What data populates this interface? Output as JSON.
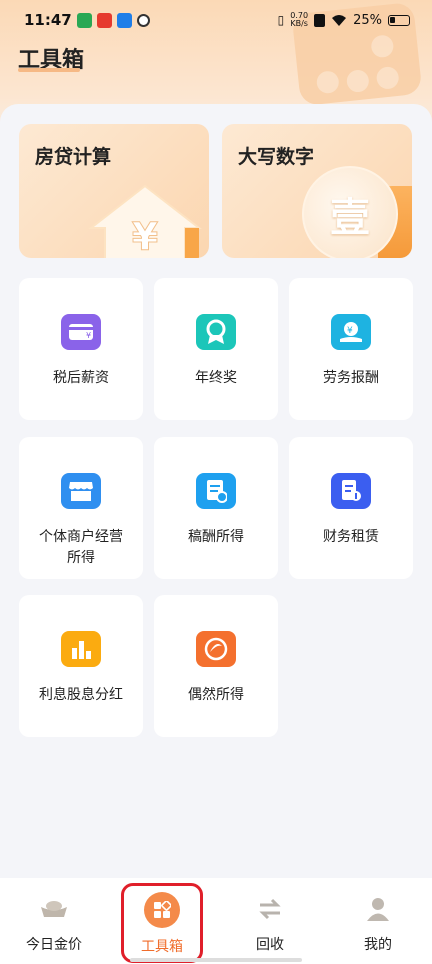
{
  "status_bar": {
    "time": "11:47",
    "net_speed_value": "0.70",
    "net_speed_unit": "KB/s",
    "battery": "25%"
  },
  "page": {
    "title": "工具箱"
  },
  "feature_cards": [
    {
      "label": "房贷计算",
      "symbol": "¥"
    },
    {
      "label": "大写数字",
      "symbol": "壹"
    }
  ],
  "tools": [
    {
      "label": "税后薪资",
      "color": "#8a63e9"
    },
    {
      "label": "年终奖",
      "color": "#1cc6b9"
    },
    {
      "label": "劳务报酬",
      "color": "#1eb3e1"
    },
    {
      "label": "个体商户经营所得",
      "color": "#2f8ff0"
    },
    {
      "label": "稿酬所得",
      "color": "#1ea0ef"
    },
    {
      "label": "财务租赁",
      "color": "#3b5ef0"
    },
    {
      "label": "利息股息分红",
      "color": "#fbab10"
    },
    {
      "label": "偶然所得",
      "color": "#f4702e"
    }
  ],
  "bottom_nav": [
    {
      "label": "今日金价",
      "icon": "gold-ingot-icon"
    },
    {
      "label": "工具箱",
      "icon": "toolbox-icon",
      "active": true
    },
    {
      "label": "回收",
      "icon": "swap-arrows-icon"
    },
    {
      "label": "我的",
      "icon": "user-icon"
    }
  ],
  "colors": {
    "accent": "#f06c2b",
    "highlight_border": "#e01f2a"
  }
}
